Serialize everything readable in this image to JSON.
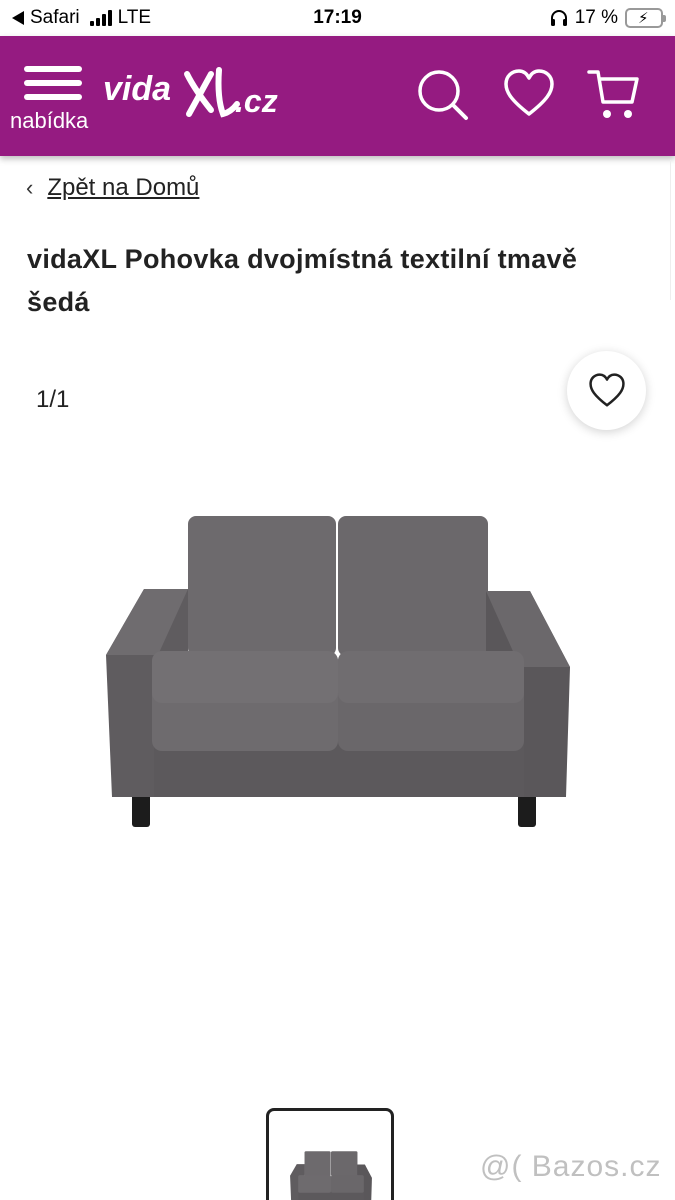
{
  "status_bar": {
    "back_app": "Safari",
    "network": "LTE",
    "time": "17:19",
    "battery": "17 %",
    "battery_level": 0.17
  },
  "header": {
    "menu_label": "nabídka",
    "logo": "vidaXL.cz",
    "brand_color": "#951b81",
    "icons": [
      "search-icon",
      "heart-icon",
      "cart-icon"
    ]
  },
  "breadcrumb": {
    "link": "Zpět na Domů"
  },
  "product": {
    "title": "vidaXL Pohovka dvojmístná textilní tmavě šedá"
  },
  "gallery": {
    "counter": "1/1",
    "image": "grey two-seater fabric sofa"
  },
  "watermark": "@( Bazos.cz"
}
